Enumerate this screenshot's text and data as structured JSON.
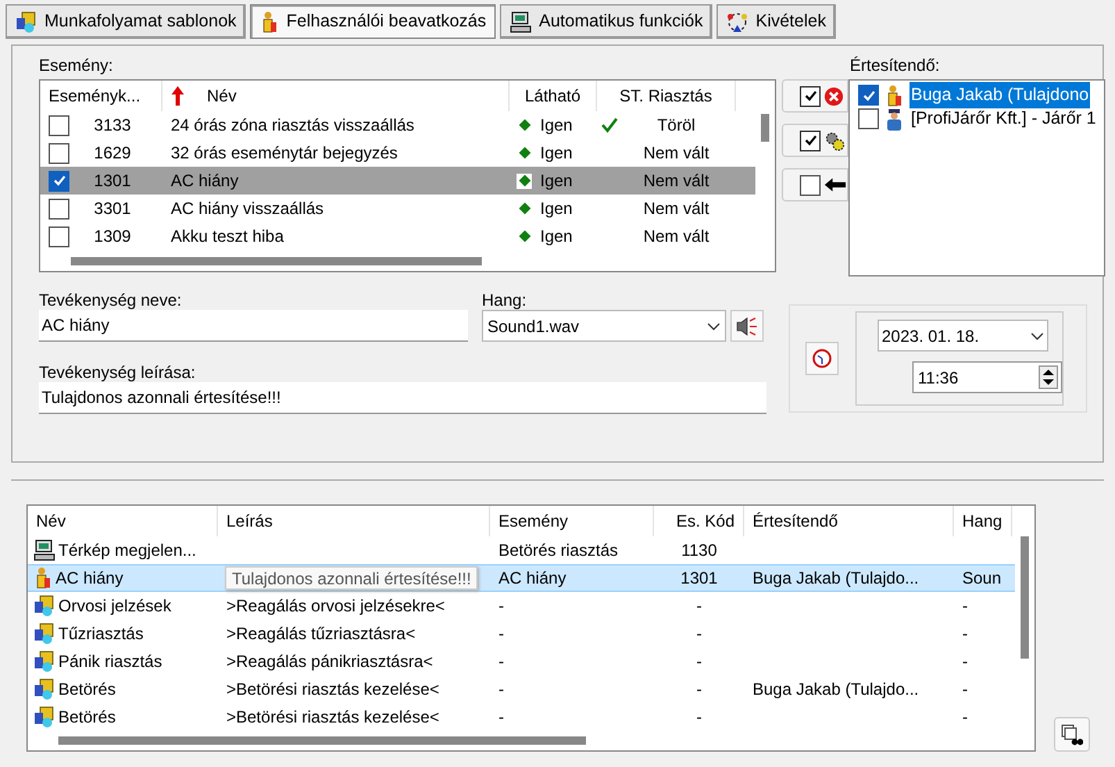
{
  "tabs": [
    {
      "label": "Munkafolyamat sablonok",
      "kind": "workflow",
      "selected": false
    },
    {
      "label": "Felhasználói beavatkozás",
      "kind": "person",
      "selected": true
    },
    {
      "label": "Automatikus funkciók",
      "kind": "computer",
      "selected": false
    },
    {
      "label": "Kivételek",
      "kind": "exceptions",
      "selected": false
    }
  ],
  "events": {
    "label": "Esemény:",
    "columns": [
      {
        "label": "Eseményk...",
        "sorted": false
      },
      {
        "label": "Név",
        "sorted": true
      },
      {
        "label": "Látható",
        "sorted": false
      },
      {
        "label": "ST. Riasztás",
        "sorted": false
      }
    ],
    "rows": [
      {
        "checked": false,
        "code": "3133",
        "name": "24 órás zóna riasztás visszaállás",
        "visible": true,
        "visible_text": "Igen",
        "st_mark": true,
        "st": "Töröl",
        "selected": false
      },
      {
        "checked": false,
        "code": "1629",
        "name": "32 órás eseménytár bejegyzés",
        "visible": true,
        "visible_text": "Igen",
        "st_mark": false,
        "st": "Nem vált",
        "selected": false
      },
      {
        "checked": true,
        "code": "1301",
        "name": "AC hiány",
        "visible": true,
        "visible_text": "Igen",
        "st_mark": false,
        "st": "Nem vált",
        "selected": true
      },
      {
        "checked": false,
        "code": "3301",
        "name": "AC hiány visszaállás",
        "visible": true,
        "visible_text": "Igen",
        "st_mark": false,
        "st": "Nem vált",
        "selected": false
      },
      {
        "checked": false,
        "code": "1309",
        "name": "Akku teszt hiba",
        "visible": true,
        "visible_text": "Igen",
        "st_mark": false,
        "st": "Nem vált",
        "selected": false
      }
    ]
  },
  "side_buttons": [
    {
      "kind": "delete",
      "checked": true
    },
    {
      "kind": "gears",
      "checked": true
    },
    {
      "kind": "arrow",
      "checked": false
    }
  ],
  "recipients": {
    "label": "Értesítendő:",
    "items": [
      {
        "name": "Buga Jakab (Tulajdono",
        "kind": "person",
        "checked": true,
        "selected": true
      },
      {
        "name": "[ProfiJárőr Kft.] - Járőr 1",
        "kind": "guard",
        "checked": false,
        "selected": false
      }
    ]
  },
  "form": {
    "name_label": "Tevékenység neve:",
    "name_value": "AC hiány",
    "sound_label": "Hang:",
    "sound_value": "Sound1.wav",
    "description_label": "Tevékenység leírása:",
    "description_value": "Tulajdonos azonnali értesítése!!!",
    "date": "2023. 01. 18.",
    "time": "11:36"
  },
  "actions": {
    "columns": [
      "Név",
      "Leírás",
      "Esemény",
      "Es. Kód",
      "Értesítendő",
      "Hang"
    ],
    "tooltip": "Tulajdonos azonnali értesítése!!!",
    "rows": [
      {
        "kind": "computer",
        "name": "Térkép megjelen...",
        "event": "Betörés riasztás",
        "code": "1130",
        "selected": false
      },
      {
        "kind": "person",
        "name": "AC hiány",
        "event": "AC hiány",
        "code": "1301",
        "notify": "Buga Jakab (Tulajdo...",
        "sound": "Soun",
        "selected": true,
        "tooltip": true
      },
      {
        "kind": "workflow",
        "name": "Orvosi jelzések",
        "description": ">Reagálás orvosi jelzésekre<",
        "event": "-",
        "code": "-",
        "sound": "-",
        "selected": false
      },
      {
        "kind": "workflow",
        "name": "Tűzriasztás",
        "description": ">Reagálás tűzriasztásra<",
        "event": "-",
        "code": "-",
        "sound": "-",
        "selected": false
      },
      {
        "kind": "workflow",
        "name": "Pánik riasztás",
        "description": ">Reagálás pánikriasztásra<",
        "event": "-",
        "code": "-",
        "sound": "-",
        "selected": false
      },
      {
        "kind": "workflow",
        "name": "Betörés",
        "description": ">Betörési riasztás kezelése<",
        "event": "-",
        "code": "-",
        "notify": "Buga Jakab (Tulajdo...",
        "sound": "-",
        "selected": false
      },
      {
        "kind": "workflow",
        "name": "Betörés",
        "description": ">Betörési riasztás kezelése<",
        "event": "-",
        "code": "-",
        "sound": "-",
        "selected": false
      }
    ]
  }
}
